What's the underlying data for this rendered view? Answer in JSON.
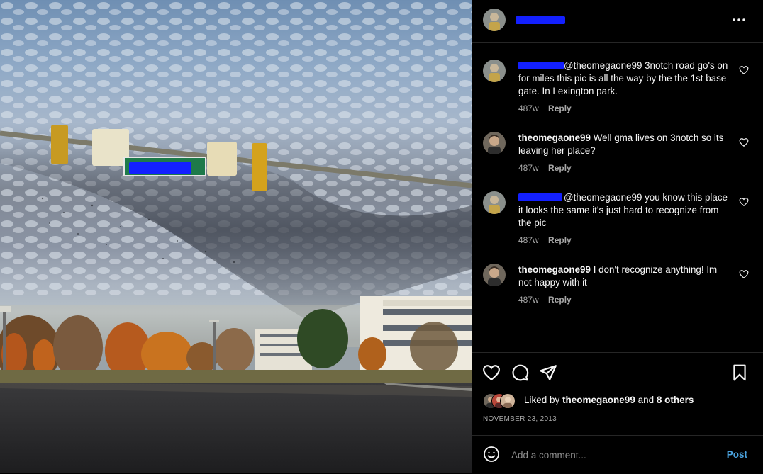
{
  "post": {
    "author_redacted": true,
    "date": "NOVEMBER 23, 2013"
  },
  "header": {
    "more_icon": "more-horizontal-icon"
  },
  "comments": [
    {
      "user": "",
      "user_redacted": true,
      "text": "@theomegaone99 3notch road go's on for miles this pic is all the way by the the 1st base gate. In Lexington park.",
      "time": "487w",
      "reply": "Reply"
    },
    {
      "user": "theomegaone99",
      "user_redacted": false,
      "text": "Well gma lives on 3notch so its leaving her place?",
      "time": "487w",
      "reply": "Reply"
    },
    {
      "user": "",
      "user_redacted": true,
      "text": "@theomegaone99 you know this place it looks the same it's just hard to recognize from the pic",
      "time": "487w",
      "reply": "Reply"
    },
    {
      "user": "theomegaone99",
      "user_redacted": false,
      "text": "I don't recognize anything! Im not happy with it",
      "time": "487w",
      "reply": "Reply"
    }
  ],
  "actions": {
    "like_icon": "heart-icon",
    "comment_icon": "comment-bubble-icon",
    "share_icon": "paper-plane-icon",
    "save_icon": "bookmark-icon"
  },
  "likes": {
    "prefix": "Liked by ",
    "user": "theomegaone99",
    "middle": " and ",
    "others": "8 others"
  },
  "composer": {
    "placeholder": "Add a comment...",
    "post_label": "Post",
    "emoji_icon": "emoji-smile-icon"
  },
  "colors": {
    "background": "#000000",
    "text": "#f5f5f5",
    "muted": "#a8a8a8",
    "link": "#4aa3df",
    "redaction": "#1320ff",
    "divider": "#262626"
  }
}
